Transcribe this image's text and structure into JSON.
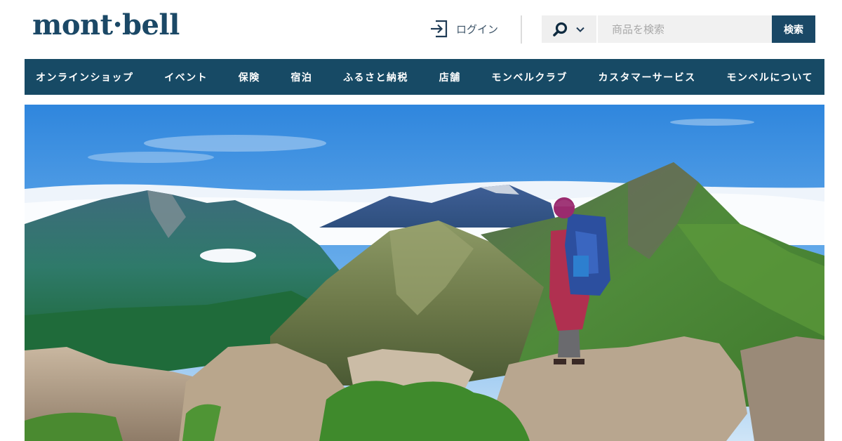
{
  "header": {
    "logo_text": "mont·bell",
    "login_label": "ログイン",
    "search": {
      "placeholder": "商品を検索",
      "button_label": "検索"
    }
  },
  "nav": {
    "items": [
      {
        "label": "オンラインショップ"
      },
      {
        "label": "イベント"
      },
      {
        "label": "保険"
      },
      {
        "label": "宿泊"
      },
      {
        "label": "ふるさと納税"
      },
      {
        "label": "店舗"
      },
      {
        "label": "モンベルクラブ"
      },
      {
        "label": "カスタマーサービス"
      },
      {
        "label": "モンベルについて"
      }
    ]
  },
  "colors": {
    "brand_navy": "#174a65",
    "logo": "#1b4866",
    "search_bg": "#f1f1f1"
  },
  "icons": {
    "login": "login-arrow-icon",
    "search_scope": "search-icon",
    "dropdown": "chevron-down-icon"
  }
}
